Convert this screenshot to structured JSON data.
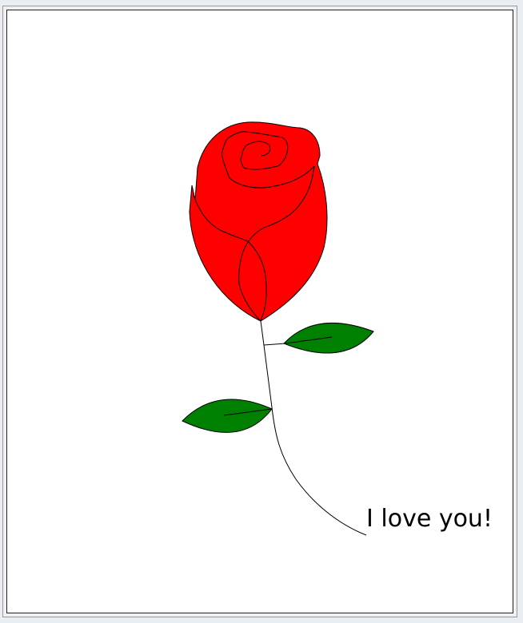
{
  "message": "I love you!",
  "colors": {
    "petal": "#ff0000",
    "leaf": "#008000",
    "outline": "#000000"
  },
  "icons": [
    "rose-drawing"
  ]
}
